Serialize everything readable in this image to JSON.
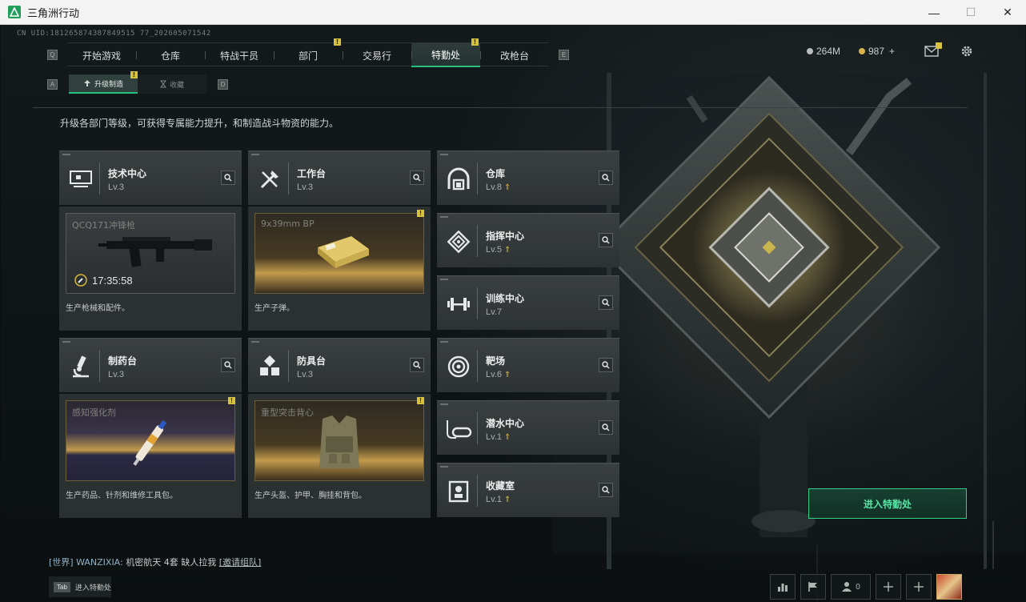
{
  "window": {
    "title": "三角洲行动",
    "minimize": "—",
    "maximize": "☐",
    "close": "✕"
  },
  "uid": "CN UID:181265874387849515 77_202605071542",
  "nav": {
    "left_key": "Q",
    "right_key": "E",
    "tabs": [
      {
        "label": "开始游戏",
        "badge": ""
      },
      {
        "label": "仓库",
        "badge": ""
      },
      {
        "label": "特战干员",
        "badge": ""
      },
      {
        "label": "部门",
        "badge": "!"
      },
      {
        "label": "交易行",
        "badge": ""
      },
      {
        "label": "特勤处",
        "badge": "!"
      },
      {
        "label": "改枪台",
        "badge": ""
      }
    ],
    "active": "特勤处"
  },
  "currency": {
    "silver": "264M",
    "gold": "987",
    "plus": "+"
  },
  "subnav": {
    "left_key": "A",
    "right_key": "D",
    "tab1": "升级制造",
    "tab1_badge": "!",
    "tab2": "收藏"
  },
  "description": "升级各部门等级，可获得专属能力提升，和制造战斗物资的能力。",
  "stations_main": [
    {
      "title": "技术中心",
      "level": "Lv.3",
      "icon": "computer-icon",
      "product": "QCQ171冲锋枪",
      "product_desc": "生产枪械和配件。",
      "timer": "17:35:58",
      "badge": ""
    },
    {
      "title": "工作台",
      "level": "Lv.3",
      "icon": "tools-icon",
      "product": "9x39mm BP",
      "product_desc": "生产子弹。",
      "timer": "",
      "badge": "!"
    },
    {
      "title": "制药台",
      "level": "Lv.3",
      "icon": "microscope-icon",
      "product": "感知强化剂",
      "product_desc": "生产药品、针剂和维修工具包。",
      "timer": "",
      "badge": "!"
    },
    {
      "title": "防具台",
      "level": "Lv.3",
      "icon": "cubes-icon",
      "product": "重型突击背心",
      "product_desc": "生产头盔、护甲、胸挂和背包。",
      "timer": "",
      "badge": "!"
    }
  ],
  "stations_side": [
    {
      "title": "仓库",
      "level": "Lv.8",
      "upgradable": true,
      "icon": "vault-icon"
    },
    {
      "title": "指挥中心",
      "level": "Lv.5",
      "upgradable": true,
      "icon": "command-icon"
    },
    {
      "title": "训练中心",
      "level": "Lv.7",
      "upgradable": false,
      "icon": "dumbbell-icon"
    },
    {
      "title": "靶场",
      "level": "Lv.6",
      "upgradable": true,
      "icon": "target-icon"
    },
    {
      "title": "潜水中心",
      "level": "Lv.1",
      "upgradable": true,
      "icon": "diving-mask-icon"
    },
    {
      "title": "收藏室",
      "level": "Lv.1",
      "upgradable": true,
      "icon": "collection-icon"
    }
  ],
  "enter_button": "进入特勤处",
  "chat": {
    "channel": "[世界]",
    "user": "WANZIXIA:",
    "message": "机密航天  4套  缺人拉我",
    "link": "[邀请组队]"
  },
  "tab_hint": {
    "key": "Tab",
    "label": "进入特勤处"
  },
  "bottom_bar": {
    "friends_count": "0"
  },
  "colors": {
    "accent": "#27c07d",
    "badge": "#d8c23c",
    "upgrade": "#d8b83a"
  }
}
